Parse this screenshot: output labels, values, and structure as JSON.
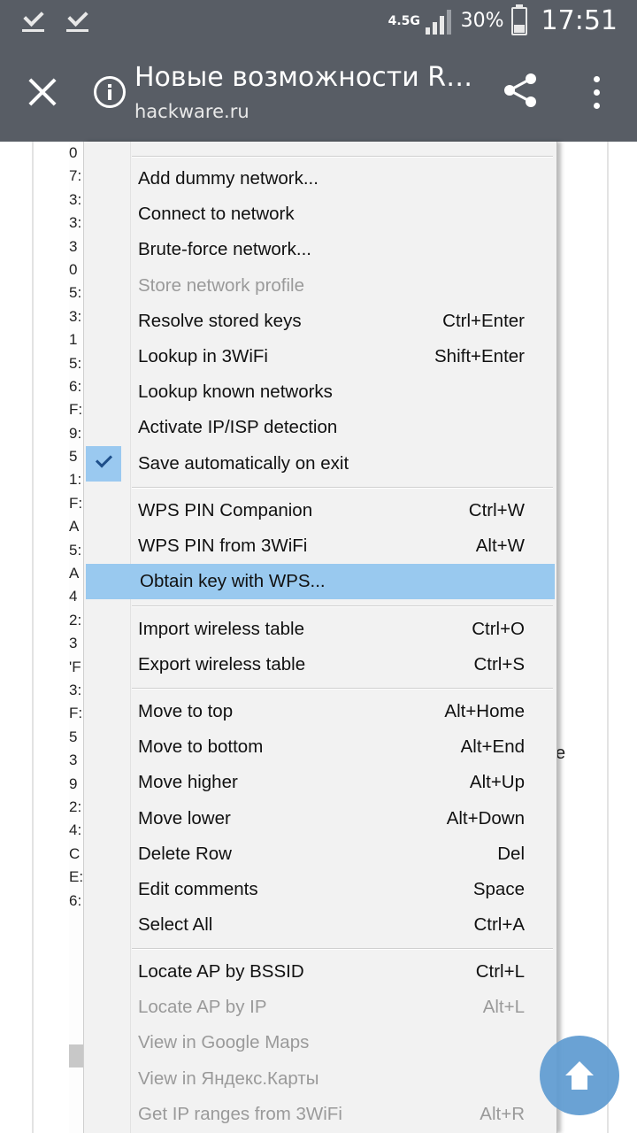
{
  "status_bar": {
    "network": "4.5G",
    "battery": "30%",
    "time": "17:51"
  },
  "app_bar": {
    "title": "Новые возможности R…",
    "url": "hackware.ru"
  },
  "background_chars": [
    "0",
    "7:",
    "3:",
    "3:",
    "3",
    "0",
    "5:",
    "3:",
    "1",
    "5:",
    "6:",
    "F:",
    "9:",
    "5",
    "1:",
    "F:",
    "A",
    "5:",
    "A",
    "4",
    "2:",
    "3",
    "'F",
    "3:",
    "F:",
    "5",
    "3",
    "9",
    "2:",
    "4:",
    "C",
    "E:",
    "6:"
  ],
  "background_stray": "e",
  "menu": {
    "group1": [
      {
        "label": "Add dummy network...",
        "shortcut": ""
      },
      {
        "label": "Connect to network",
        "shortcut": ""
      },
      {
        "label": "Brute-force network...",
        "shortcut": ""
      },
      {
        "label": "Store network profile",
        "shortcut": "",
        "disabled": true
      },
      {
        "label": "Resolve stored keys",
        "shortcut": "Ctrl+Enter"
      },
      {
        "label": "Lookup in 3WiFi",
        "shortcut": "Shift+Enter"
      },
      {
        "label": "Lookup known networks",
        "shortcut": ""
      },
      {
        "label": "Activate IP/ISP detection",
        "shortcut": ""
      },
      {
        "label": "Save automatically on exit",
        "shortcut": "",
        "checked": true
      }
    ],
    "group2": [
      {
        "label": "WPS PIN Companion",
        "shortcut": "Ctrl+W"
      },
      {
        "label": "WPS PIN from 3WiFi",
        "shortcut": "Alt+W"
      },
      {
        "label": "Obtain key with WPS...",
        "shortcut": "",
        "highlighted": true
      }
    ],
    "group3": [
      {
        "label": "Import wireless table",
        "shortcut": "Ctrl+O"
      },
      {
        "label": "Export wireless table",
        "shortcut": "Ctrl+S"
      }
    ],
    "group4": [
      {
        "label": "Move to top",
        "shortcut": "Alt+Home"
      },
      {
        "label": "Move to bottom",
        "shortcut": "Alt+End"
      },
      {
        "label": "Move higher",
        "shortcut": "Alt+Up"
      },
      {
        "label": "Move lower",
        "shortcut": "Alt+Down"
      },
      {
        "label": "Delete Row",
        "shortcut": "Del"
      },
      {
        "label": "Edit comments",
        "shortcut": "Space"
      },
      {
        "label": "Select All",
        "shortcut": "Ctrl+A"
      }
    ],
    "group5": [
      {
        "label": "Locate AP by BSSID",
        "shortcut": "Ctrl+L"
      },
      {
        "label": "Locate AP by IP",
        "shortcut": "Alt+L",
        "disabled": true
      },
      {
        "label": "View in Google Maps",
        "shortcut": "",
        "disabled": true
      },
      {
        "label": "View in Яндекс.Карты",
        "shortcut": "",
        "disabled": true
      },
      {
        "label": "Get IP ranges from 3WiFi",
        "shortcut": "Alt+R",
        "disabled": true
      }
    ]
  },
  "fab": {
    "icon": "arrow-up-icon",
    "color": "#5e9bd1"
  }
}
